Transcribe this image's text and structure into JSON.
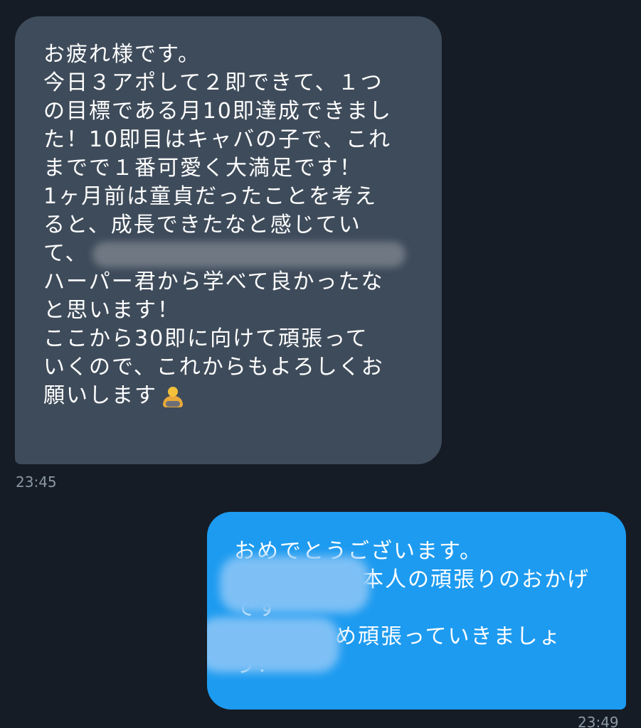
{
  "incoming": {
    "lines": [
      "お疲れ様です。",
      "今日３アポして２即できて、１つ",
      "の目標である月10即達成できまし",
      "た！10即目はキャバの子で、これ",
      "までで１番可愛く大満足です！",
      "1ヶ月前は童貞だったことを考え",
      "ると、成長できたなと感じてい",
      "て、",
      "ハーパー君から学べて良かったな",
      "と思います！",
      "ここから30即に向けて頑張って",
      "いくので、これからもよろしくお",
      "願いします"
    ],
    "emoji": "person-bowing-emoji",
    "time": "23:45"
  },
  "outgoing": {
    "lines": [
      "おめでとうございます。",
      "本人の頑張りのおかげ",
      "です",
      "め頑張っていきましょ",
      "う！"
    ],
    "time": "23:49"
  },
  "colors": {
    "background": "#151c25",
    "incoming_bubble": "#3e4b5a",
    "outgoing_bubble": "#1d9bf0",
    "timestamp": "#8b98a5"
  }
}
